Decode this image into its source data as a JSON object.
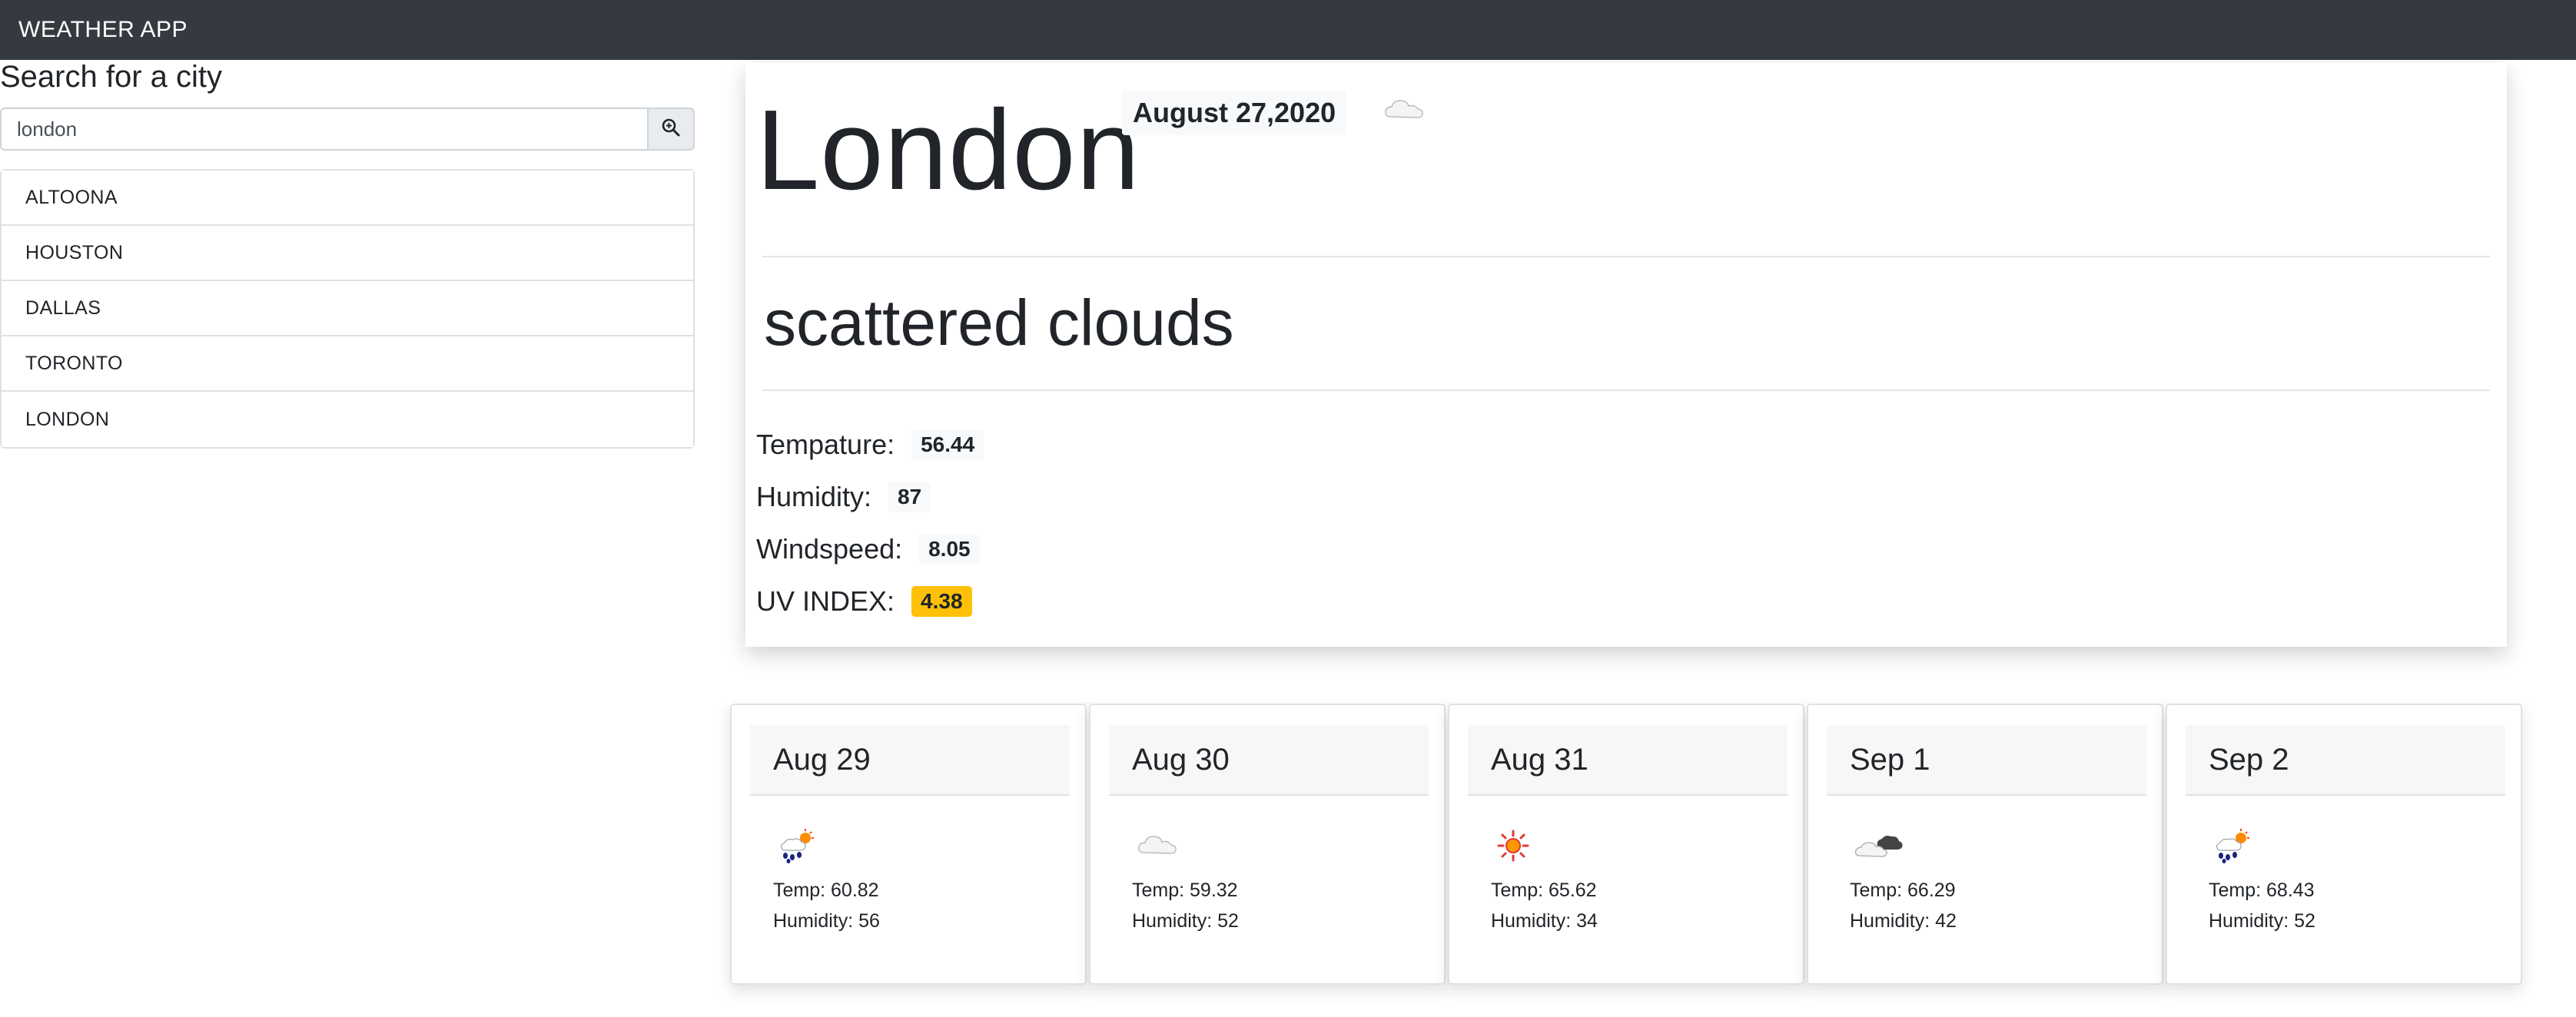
{
  "navbar": {
    "title": "WEATHER APP"
  },
  "search": {
    "title": "Search for a city",
    "value": "london",
    "button_icon": "search-icon"
  },
  "cities": [
    "ALTOONA",
    "HOUSTON",
    "DALLAS",
    "TORONTO",
    "LONDON"
  ],
  "current": {
    "city": "London",
    "date": "August 27,2020",
    "icon": "cloud-icon",
    "description": "scattered clouds",
    "temp_label": "Tempature:",
    "temp_value": "56.44",
    "humidity_label": "Humidity:",
    "humidity_value": "87",
    "wind_label": "Windspeed:",
    "wind_value": "8.05",
    "uv_label": "UV INDEX:",
    "uv_value": "4.38"
  },
  "forecast": [
    {
      "date": "Aug 29",
      "icon": "sun-rain-icon",
      "temp": "Temp: 60.82",
      "humidity": "Humidity: 56"
    },
    {
      "date": "Aug 30",
      "icon": "cloud-icon",
      "temp": "Temp: 59.32",
      "humidity": "Humidity: 52"
    },
    {
      "date": "Aug 31",
      "icon": "sun-icon",
      "temp": "Temp: 65.62",
      "humidity": "Humidity: 34"
    },
    {
      "date": "Sep 1",
      "icon": "cloudy-icon",
      "temp": "Temp: 66.29",
      "humidity": "Humidity: 42"
    },
    {
      "date": "Sep 2",
      "icon": "sun-rain-icon",
      "temp": "Temp: 68.43",
      "humidity": "Humidity: 52"
    }
  ],
  "colors": {
    "navbar": "#343a40",
    "uv_badge": "#ffc107"
  }
}
